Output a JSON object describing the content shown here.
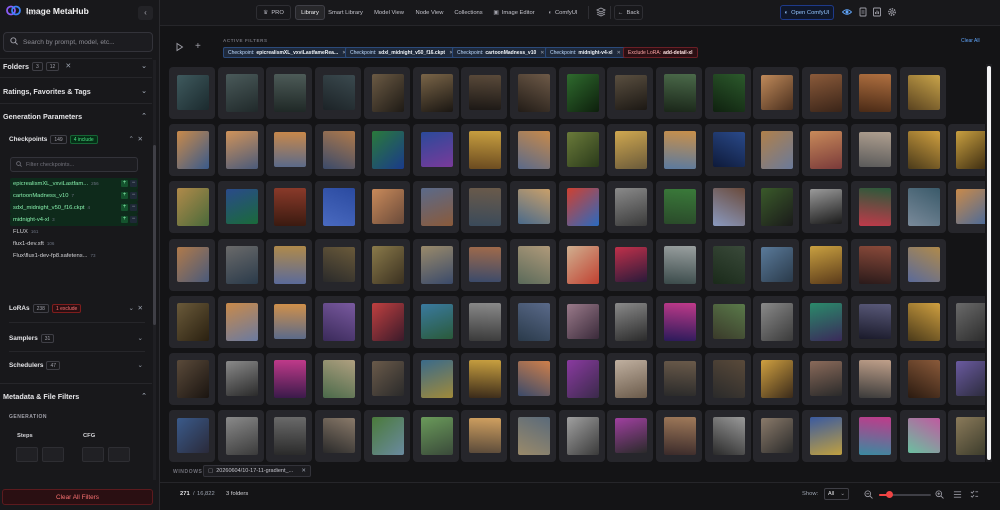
{
  "app": {
    "name": "Image MetaHub",
    "version": "v0.17.5"
  },
  "search": {
    "placeholder": "Search by prompt, model, etc..."
  },
  "sidebar": {
    "folders": {
      "label": "Folders",
      "count_a": "3",
      "count_b": "12"
    },
    "ratings": {
      "label": "Ratings, Favorites & Tags"
    },
    "generation": {
      "label": "Generation Parameters"
    },
    "checkpoints": {
      "label": "Checkpoints",
      "count": "149",
      "badge": "4 include",
      "filter_placeholder": "Filter checkpoints...",
      "items": [
        {
          "name": "epicrealismXL_vxviLastfam...",
          "count": "256",
          "state": "include"
        },
        {
          "name": "cartoonMadness_v10",
          "count": "7",
          "state": "include"
        },
        {
          "name": "sdxl_midnight_v50_f16.ckpt",
          "count": "4",
          "state": "include"
        },
        {
          "name": "midnight-v4-xl",
          "count": "3",
          "state": "include"
        },
        {
          "name": "FLUX",
          "count": "161",
          "state": "none"
        },
        {
          "name": "flux1-dev.sft",
          "count": "106",
          "state": "none"
        },
        {
          "name": "Flux\\flux1-dev-fp8.safetens...",
          "count": "73",
          "state": "none"
        }
      ]
    },
    "loras": {
      "label": "LoRAs",
      "count": "238",
      "badge": "1 exclude"
    },
    "samplers": {
      "label": "Samplers",
      "count": "31"
    },
    "schedulers": {
      "label": "Schedulers",
      "count": "47"
    },
    "metadata": {
      "label": "Metadata & File Filters",
      "sub_label": "GENERATION",
      "steps": "Steps",
      "cfg": "CFG"
    },
    "clear_all": "Clear All Filters"
  },
  "topbar": {
    "pro": "PRO",
    "tabs": [
      "Library",
      "Smart Library",
      "Model View",
      "Node View",
      "Collections",
      "Image Editor",
      "ComfyUI"
    ],
    "back": "Back",
    "open_comfy": "Open ComfyUI"
  },
  "filters": {
    "label": "ACTIVE FILTERS",
    "clear": "Clear All",
    "chips": [
      {
        "prefix": "Checkpoint:",
        "value": "epicrealismXL_vxviLastfameRea...",
        "type": "include"
      },
      {
        "prefix": "Checkpoint:",
        "value": "sdxl_midnight_v50_f16.ckpt",
        "type": "include"
      },
      {
        "prefix": "Checkpoint:",
        "value": "cartoonMadness_v10",
        "type": "include"
      },
      {
        "prefix": "Checkpoint:",
        "value": "midnight-v4-xl",
        "type": "include"
      },
      {
        "prefix": "Exclude LoRA:",
        "value": "add-detail-xl",
        "type": "exclude"
      }
    ]
  },
  "windows": {
    "label": "WINDOWS",
    "tab": "20260604/10-17-11-gradient_..."
  },
  "footer": {
    "shown": "271",
    "total": "16,822",
    "folders": "3 folders",
    "show_label": "Show:",
    "show_value": "All",
    "zoom": 0.2
  },
  "colors": {
    "accent": "#3b82f6",
    "include": "#22c55e",
    "exclude": "#ef4444",
    "zoom_slider": "#ef4444"
  },
  "grid": {
    "rows": [
      [
        "#3f5a5e,#1b2a2e",
        "#4a5a5a,#20292a",
        "#4d5b58,#1f2826",
        "#3b4a4f,#1c2327",
        "#6b5a44,#1e1a15",
        "#7a6548,#1a1612",
        "#5a4a3a,#1c1815",
        "#6e5a48,#221c17",
        "#2f6b2e,#0d1f0c",
        "#5a4f40,#1c1814",
        "#4b6a4a,#1a2619",
        "#2c5a2c,#0f210f",
        "#c08a5a,#4a2f1e",
        "#8a5a3a,#3a2418",
        "#b07040,#4a2a16",
        "#c9a44a,#5a4320"
      ],
      [
        "#c98a4a,#3a5a8a",
        "#d0935a,#4a5a7a",
        "#c8884a,#5a6a8a",
        "#b07a4a,#3a4a6a",
        "#2a7a3a,#1a3a8a",
        "#2a4a9a,#7a3a9a",
        "#c9a040,#6a4a20",
        "#c88a4a,#5a6a8a",
        "#6a7a3a,#2a3a1a",
        "#d0a850,#6a5a3a",
        "#c9904a,#5a7aa0",
        "#2a4a8a,#0e1a3a",
        "#b0804a,#6a7a9a",
        "#c88a5a,#7a3a3a",
        "#b0a090,#5a5a5a",
        "#d0a040,#4a3a1a",
        "#c9a040,#3a2a10"
      ],
      [
        "#b08a4a,#4a6a3a",
        "#2a4a8a,#1a6a3a",
        "#8a3a2a,#3a1a10",
        "#2a4aa0,#4a6ac0",
        "#c98a5a,#6a4a3a",
        "#5a6a8a,#8a5a3a",
        "#6a5a4a,#3a4a5a",
        "#c9a06a,#4a6a8a",
        "#d04030,#2a6ac0",
        "#8a8a8a,#3a3a3a",
        "#3a7a3a,#2a4a2a",
        "#6a4a3a,#8a9ac0",
        "#3a5a2a,#1a1a1a",
        "#9a9a9a,#1a1a1a",
        "#2a5a3a,#c03a4a",
        "#3a5a6a,#7a8a9a",
        "#c98a4a,#4a6a9a"
      ],
      [
        "#b07a4a,#4a5a7a",
        "#6a6a6a,#2a3a4a",
        "#b08a4a,#5a6a9a",
        "#6a5a3a,#2a2a2a",
        "#8a7a4a,#3a3020",
        "#9a8a6a,#3a4a6a",
        "#a06a4a,#3a4a6a",
        "#b09a7a,#5a6a5a",
        "#d0b090,#c04030",
        "#c0304a,#2a1a3a",
        "#9aa0a0,#3a4a4a",
        "#3a4a3a,#1a2a1a",
        "#5a7a9a,#2a3a4a",
        "#c9a040,#5a3a1a",
        "#8a4a3a,#2a1a1a",
        "#b08a4a,#5a6a9a"
      ],
      [
        "#6a5a3a,#2a2010",
        "#c98a4a,#6a7aa0",
        "#d0904a,#5a6a8a",
        "#7a5aa0,#3a2a5a",
        "#c04040,#3a1a2a",
        "#3a7aa0,#2a5a3a",
        "#8a8a8a,#3a3a3a",
        "#5a6a8a,#2a3a4a",
        "#9a7a8a,#3a2a3a",
        "#8a8a8a,#2a2a2a",
        "#c03a8a,#2a1a5a",
        "#5a7a4a,#3a3a2a",
        "#8a8a8a,#3a3a3a",
        "#2a8a6a,#3a2a5a",
        "#5a5a7a,#1a1a2a",
        "#d0a040,#4a3a1a",
        "#6a6a6a,#2a2a2a"
      ],
      [
        "#5a4a3a,#1a1410",
        "#8a8a8a,#2a2a2a",
        "#c03a8a,#3a1a4a",
        "#b0a080,#4a6a4a",
        "#6a5a4a,#2a2a2a",
        "#3a6a8a,#a08a3a",
        "#c9a040,#3a2a1a",
        "#d0804a,#3a4a6a",
        "#8a3aa0,#3a2a4a",
        "#c0b0a0,#6a5a4a",
        "#6a5a4a,#2a2a2a",
        "#5a4a3a,#2a2a2a",
        "#d0a040,#3a2a1a",
        "#8a6a5a,#2a2a2a",
        "#c0a08a,#3a3a3a",
        "#8a5a3a,#2a1a10",
        "#6a5aa0,#2a2a3a"
      ],
      [
        "#3a5a8a,#2a2a3a",
        "#8a8a8a,#3a3a3a",
        "#6a6a6a,#2a2a2a",
        "#8a7a6a,#2a2a2a",
        "#4a7a3a,#6a8aa0",
        "#6a9a5a,#3a4a3a",
        "#d0a060,#5a4a3a",
        "#5a6a7a,#9a8a6a",
        "#a0a0a0,#3a3a3a",
        "#a040a0,#2a2a2a",
        "#a07a5a,#3a2a2a",
        "#9a9a9a,#2a2a2a",
        "#8a7a6a,#2a2a2a",
        "#3a5aa0,#c0a040",
        "#c03a8a,#3a8aa0",
        "#c05aa0,#6ac0a0",
        "#8a7a5a,#3a3a2a"
      ]
    ]
  }
}
